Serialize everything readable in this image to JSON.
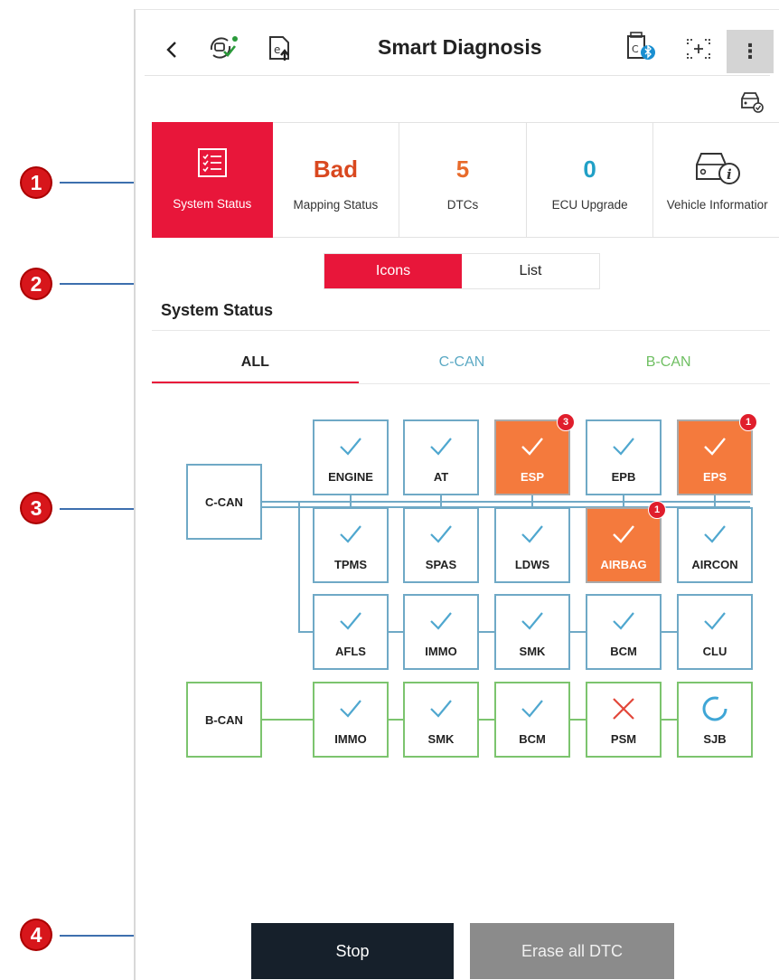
{
  "callouts": [
    "1",
    "2",
    "3",
    "4"
  ],
  "header": {
    "title": "Smart Diagnosis",
    "back_icon": "chevron-left-icon",
    "icons": [
      "vehicle-scan-icon",
      "e-upload-icon",
      "vci-bluetooth-icon",
      "screenshot-icon",
      "more-vert-icon",
      "vehicle-check-icon"
    ],
    "more_label": "⋮"
  },
  "cards": [
    {
      "value": "",
      "label": "System Status",
      "icon": "checklist-icon"
    },
    {
      "value": "Bad",
      "label": "Mapping Status",
      "color": "#d9481f"
    },
    {
      "value": "5",
      "label": "DTCs",
      "color": "#e86a2a"
    },
    {
      "value": "0",
      "label": "ECU Upgrade",
      "color": "#21a0c6"
    },
    {
      "value": "",
      "label": "Vehicle Informatior",
      "icon": "vehicle-info-icon"
    }
  ],
  "view_toggle": {
    "icons": "Icons",
    "list": "List"
  },
  "section_title": "System Status",
  "tabs": {
    "all": "ALL",
    "ccan": "C-CAN",
    "bcan": "B-CAN"
  },
  "diagram": {
    "ccan_label": "C-CAN",
    "bcan_label": "B-CAN",
    "ccan_rows": [
      [
        {
          "name": "ENGINE",
          "status": "ok"
        },
        {
          "name": "AT",
          "status": "ok"
        },
        {
          "name": "ESP",
          "status": "error",
          "dtc": "3"
        },
        {
          "name": "EPB",
          "status": "ok"
        },
        {
          "name": "EPS",
          "status": "error",
          "dtc": "1"
        }
      ],
      [
        {
          "name": "TPMS",
          "status": "ok"
        },
        {
          "name": "SPAS",
          "status": "ok"
        },
        {
          "name": "LDWS",
          "status": "ok"
        },
        {
          "name": "AIRBAG",
          "status": "error",
          "dtc": "1"
        },
        {
          "name": "AIRCON",
          "status": "ok"
        }
      ],
      [
        {
          "name": "AFLS",
          "status": "ok"
        },
        {
          "name": "IMMO",
          "status": "ok"
        },
        {
          "name": "SMK",
          "status": "ok"
        },
        {
          "name": "BCM",
          "status": "ok"
        },
        {
          "name": "CLU",
          "status": "ok"
        }
      ]
    ],
    "bcan_row": [
      {
        "name": "IMMO",
        "status": "ok"
      },
      {
        "name": "SMK",
        "status": "ok"
      },
      {
        "name": "BCM",
        "status": "ok"
      },
      {
        "name": "PSM",
        "status": "fail"
      },
      {
        "name": "SJB",
        "status": "loading"
      }
    ]
  },
  "footer": {
    "stop": "Stop",
    "erase": "Erase all DTC"
  },
  "colors": {
    "accent": "#e8163a",
    "error": "#f47a3d",
    "ccan": "#6fa9c6",
    "bcan": "#7cc46e",
    "check": "#4fa7cf"
  }
}
